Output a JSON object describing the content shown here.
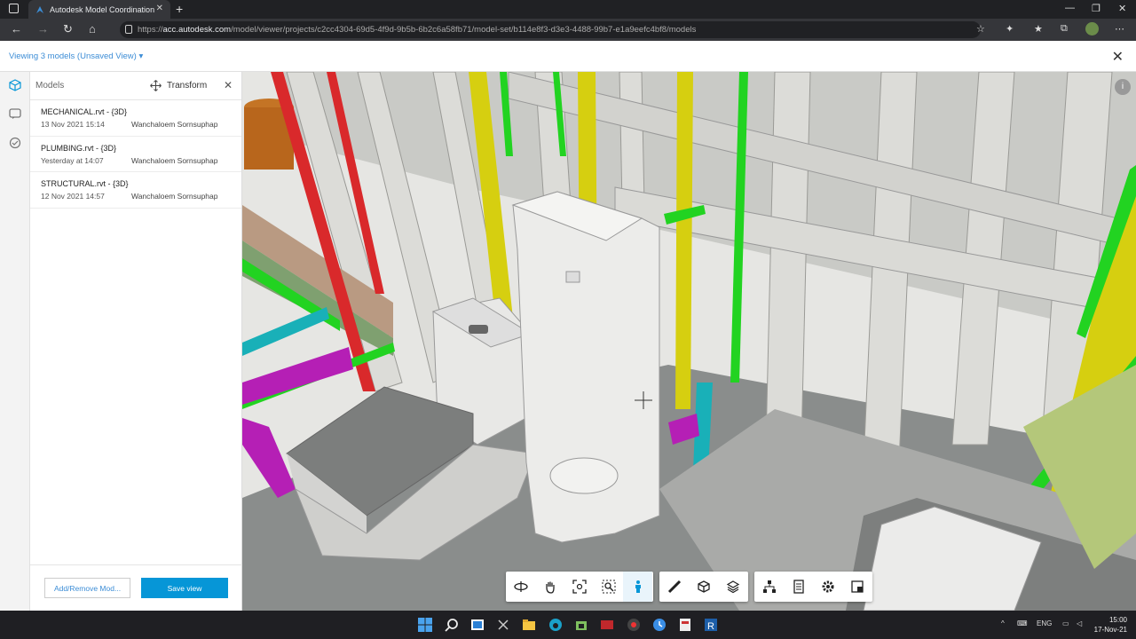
{
  "browser": {
    "tab_title": "Autodesk Model Coordination",
    "url_prefix": "https://",
    "url_host": "acc.autodesk.com",
    "url_path": "/model/viewer/projects/c2cc4304-69d5-4f9d-9b5b-6b2c6a58fb71/model-set/b114e8f3-d3e3-4488-99b7-e1a9eefc4bf8/models"
  },
  "header": {
    "viewing_label": "Viewing 3 models (Unsaved View)",
    "dropdown_caret": "▾"
  },
  "panel": {
    "models_label": "Models",
    "transform_label": "Transform",
    "models": [
      {
        "name": "MECHANICAL.rvt - {3D}",
        "date": "13 Nov 2021 15:14",
        "user": "Wanchaloem Sornsuphap"
      },
      {
        "name": "PLUMBING.rvt - {3D}",
        "date": "Yesterday at 14:07",
        "user": "Wanchaloem Sornsuphap"
      },
      {
        "name": "STRUCTURAL.rvt - {3D}",
        "date": "12 Nov 2021 14:57",
        "user": "Wanchaloem Sornsuphap"
      }
    ],
    "add_remove_label": "Add/Remove Mod...",
    "save_view_label": "Save view"
  },
  "toolbar": {
    "groups": [
      [
        "orbit-icon",
        "pan-icon",
        "fit-view-icon",
        "zoom-window-icon",
        "first-person-icon"
      ],
      [
        "measure-icon",
        "section-box-icon",
        "layers-icon"
      ],
      [
        "model-browser-icon",
        "properties-icon",
        "settings-icon",
        "fullscreen-icon"
      ]
    ],
    "active_tool": "first-person-icon"
  },
  "taskbar": {
    "lang": "ENG",
    "time": "15:00",
    "date": "17-Nov-21"
  },
  "colors": {
    "accent": "#0696d7",
    "link": "#3c8dd6",
    "pipe_red": "#d9292b",
    "pipe_yellow": "#d6cf10",
    "pipe_green": "#22d321",
    "pipe_magenta": "#b51fb5",
    "pipe_cyan": "#19b0b8"
  }
}
